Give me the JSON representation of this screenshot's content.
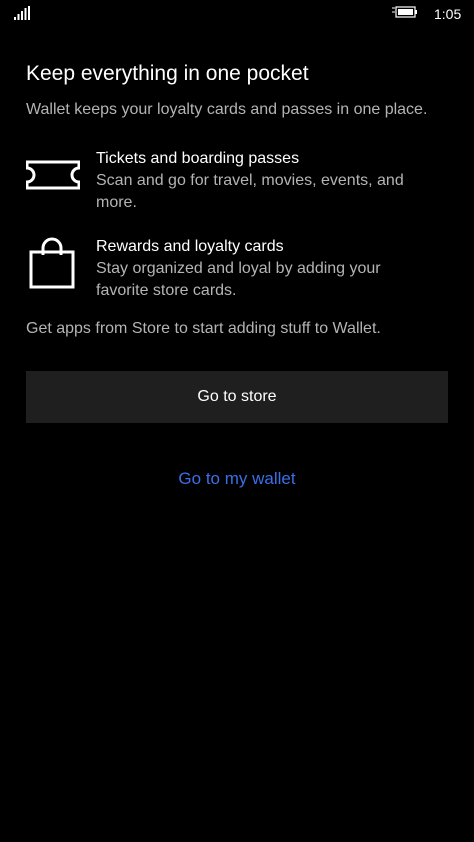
{
  "status_bar": {
    "signal_icon": "signal-bars-icon",
    "battery_icon": "battery-charging-icon",
    "time": "1:05"
  },
  "page": {
    "title": "Keep everything in one pocket",
    "subtitle": "Wallet keeps your loyalty cards and passes in one place."
  },
  "features": [
    {
      "icon": "ticket-icon",
      "title": "Tickets and boarding passes",
      "description": "Scan and go for travel, movies, events, and more."
    },
    {
      "icon": "shopping-bag-icon",
      "title": "Rewards and loyalty cards",
      "description": "Stay organized and loyal by adding your favorite store cards."
    }
  ],
  "store_note": "Get apps from Store to start adding stuff to Wallet.",
  "buttons": {
    "go_to_store": "Go to store",
    "go_to_wallet": "Go to my wallet"
  },
  "colors": {
    "background": "#000000",
    "primary_text": "#ffffff",
    "secondary_text": "#b4b4b4",
    "button_bg": "#1f1f1f",
    "link": "#3b6fe8"
  }
}
